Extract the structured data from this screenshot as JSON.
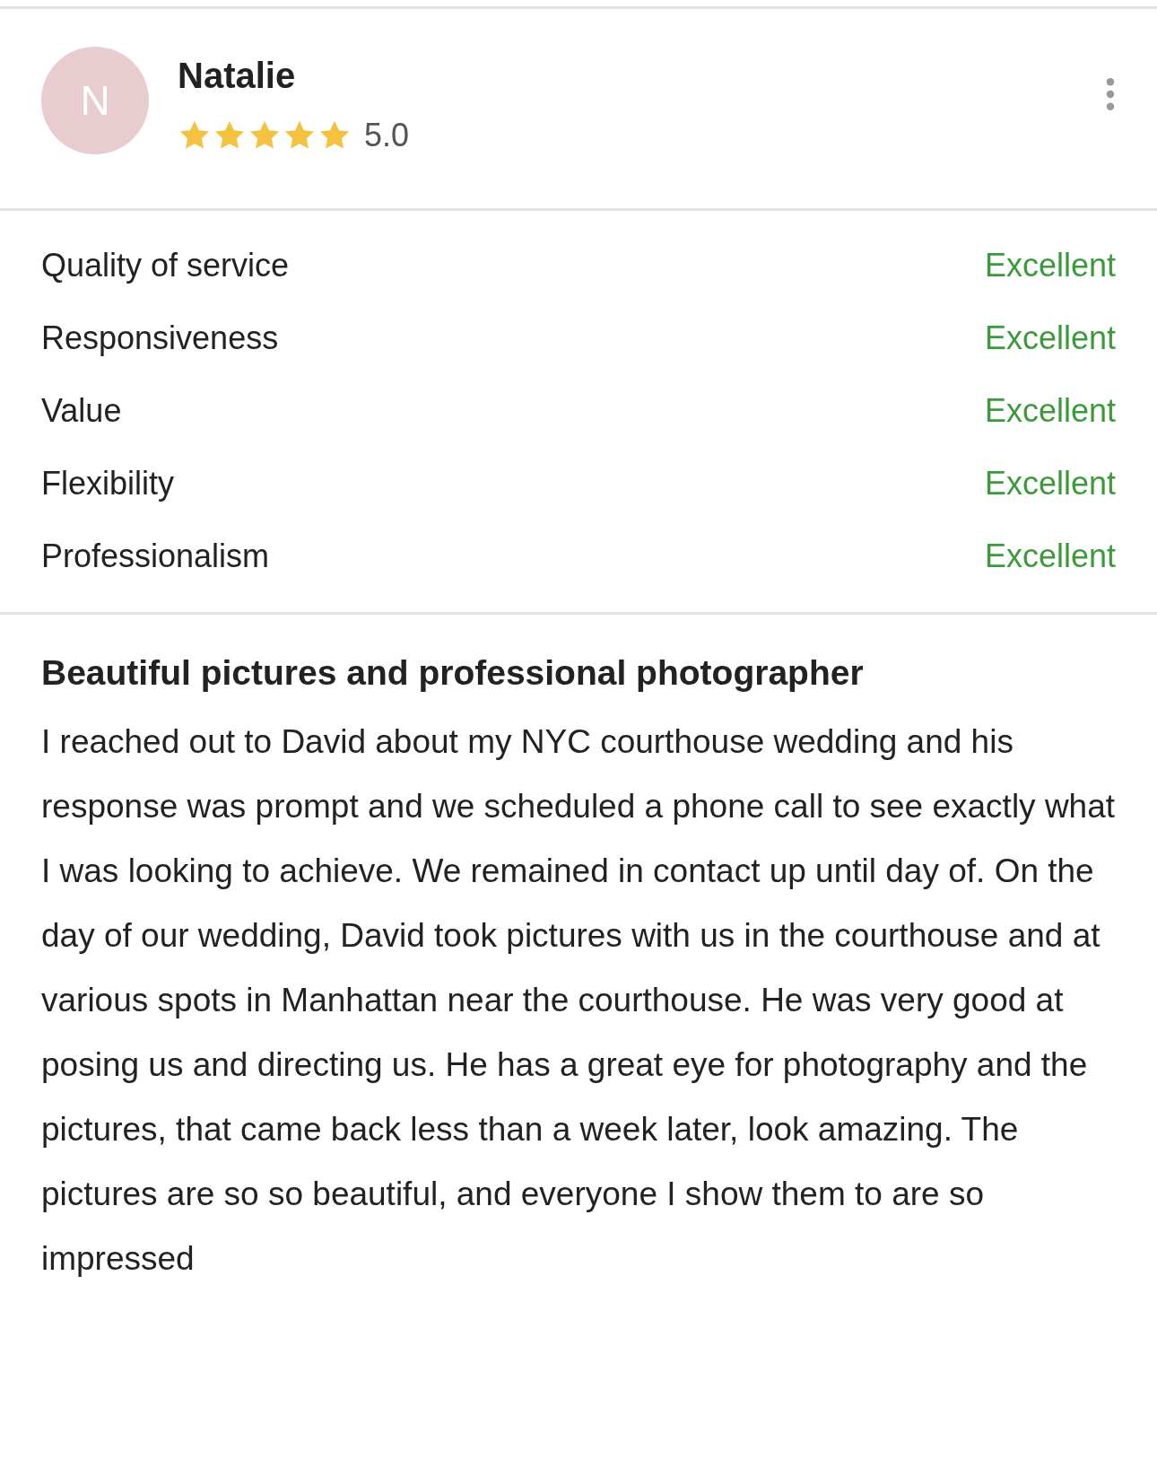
{
  "review": {
    "avatar_letter": "N",
    "name": "Natalie",
    "stars": 5,
    "score": "5.0"
  },
  "ratings": [
    {
      "label": "Quality of service",
      "value": "Excellent"
    },
    {
      "label": "Responsiveness",
      "value": "Excellent"
    },
    {
      "label": "Value",
      "value": "Excellent"
    },
    {
      "label": "Flexibility",
      "value": "Excellent"
    },
    {
      "label": "Professionalism",
      "value": "Excellent"
    }
  ],
  "title": "Beautiful pictures and professional photographer",
  "body": "I reached out to David about my NYC courthouse wedding and his response was prompt and we scheduled a phone call to see exactly what I was looking to achieve. We remained in contact up until day of. On the day of our wedding, David took pictures with us in the courthouse and at various spots in Manhattan near the courthouse. He was very good at posing us and directing us. He has a great eye for photography and the pictures, that came back less than a week later, look amazing. The pictures are so so beautiful, and everyone I show them to are so impressed"
}
